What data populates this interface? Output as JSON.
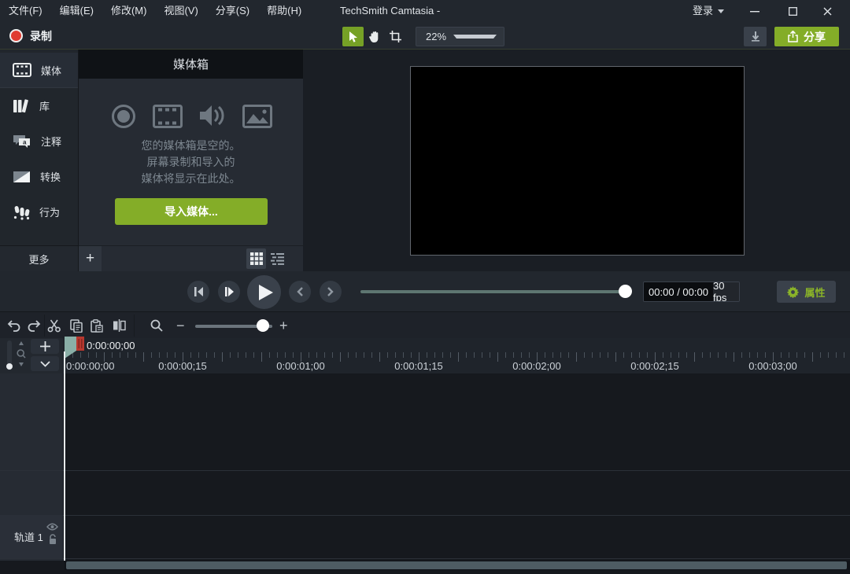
{
  "colors": {
    "accent_green": "#84ad28",
    "tool_selected_green": "#76a126",
    "record_red": "#e03c31",
    "playhead_teal": "#8aafa7",
    "background_dark": "#16191e",
    "panel": "#262b33"
  },
  "menu_bar": {
    "items": [
      "文件(F)",
      "编辑(E)",
      "修改(M)",
      "视图(V)",
      "分享(S)",
      "帮助(H)"
    ],
    "title": "TechSmith Camtasia -",
    "sign_in_label": "登录"
  },
  "toolbar": {
    "record_label": "录制",
    "zoom_value": "22%",
    "share_label": "分享"
  },
  "sidebar": {
    "items": [
      "媒体",
      "库",
      "注释",
      "转换",
      "行为"
    ],
    "more_label": "更多"
  },
  "media_bin": {
    "title": "媒体箱",
    "empty_line1": "您的媒体箱是空的。",
    "empty_line2": "屏幕录制和导入的",
    "empty_line3": "媒体将显示在此处。",
    "import_button_label": "导入媒体..."
  },
  "playback": {
    "time_display": "00:00 / 00:00",
    "fps_display": "30 fps",
    "properties_label": "属性"
  },
  "timeline": {
    "playhead_time": "0:00:00;00",
    "ruler_labels": [
      "0:00:00;00",
      "0:00:00;15",
      "0:00:01;00",
      "0:00:01;15",
      "0:00:02;00",
      "0:00:02;15",
      "0:00:03;00"
    ],
    "track1_label": "轨道 1"
  }
}
